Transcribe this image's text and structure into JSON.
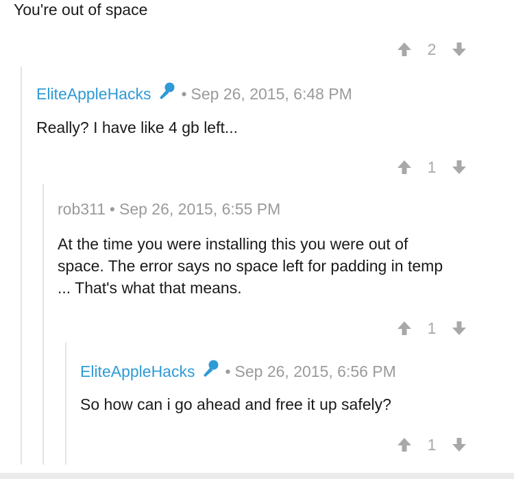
{
  "top_comment": {
    "body": "You're out of space",
    "score": "2"
  },
  "comments": [
    {
      "author": "EliteAppleHacks",
      "author_badge_icon": "microphone-icon",
      "timestamp": "Sep 26, 2015, 6:48 PM",
      "body": "Really? I have like 4 gb left...",
      "score": "1"
    },
    {
      "author": "rob311",
      "timestamp": "Sep 26, 2015, 6:55 PM",
      "body_lines": [
        "At the time you were installing this you were out of",
        "space. The error says no space left for padding in temp",
        "... That's what that means."
      ],
      "score": "1"
    },
    {
      "author": "EliteAppleHacks",
      "author_badge_icon": "microphone-icon",
      "timestamp": "Sep 26, 2015, 6:56 PM",
      "body": "So how can i go ahead and free it up safely?",
      "score": "1"
    }
  ],
  "separator": "•",
  "colors": {
    "op_author": "#2e9ad6",
    "meta_gray": "#9a9a9a",
    "thread_line": "#e3e3e3",
    "vote_arrow": "#a8a8a8"
  }
}
